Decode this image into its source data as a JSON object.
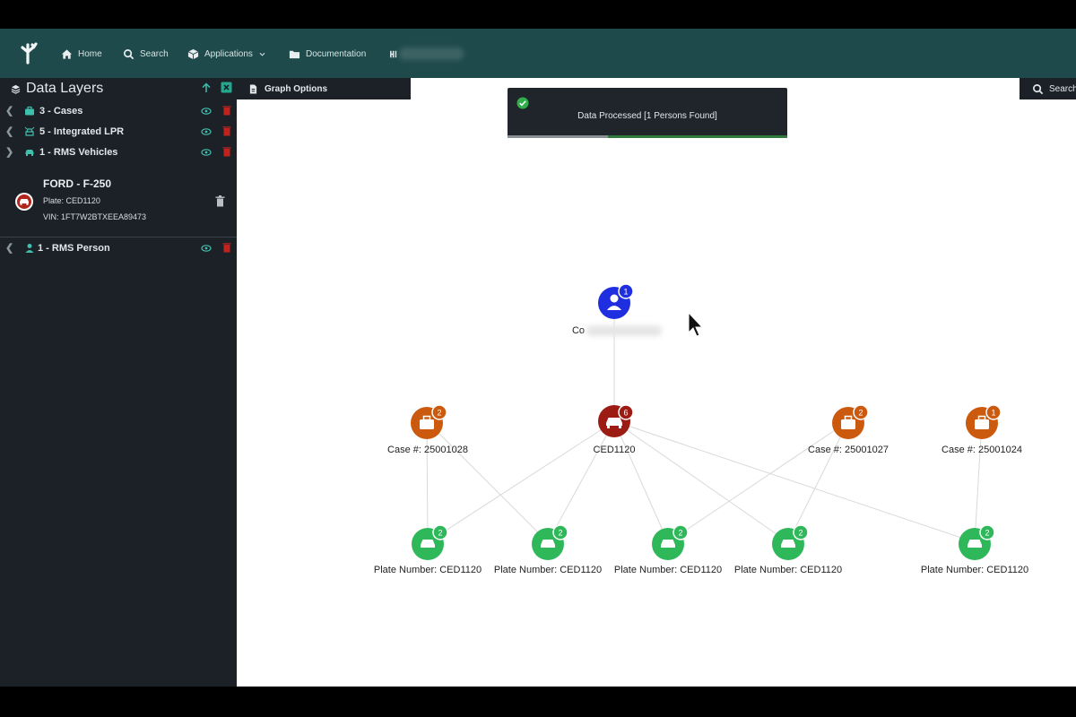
{
  "nav": {
    "items": [
      {
        "label": "Home",
        "icon": "home-icon"
      },
      {
        "label": "Search",
        "icon": "search-icon"
      },
      {
        "label": "Applications",
        "icon": "cube-icon"
      },
      {
        "label": "Documentation",
        "icon": "folder-icon"
      }
    ]
  },
  "sidebar": {
    "title": "Data Layers",
    "layers": [
      {
        "label": "3 - Cases",
        "icon": "briefcase-icon",
        "expanded": false
      },
      {
        "label": "5 - Integrated LPR",
        "icon": "lpr-camera-icon",
        "expanded": false
      },
      {
        "label": "1 - RMS Vehicles",
        "icon": "car-icon",
        "expanded": true
      }
    ],
    "vehicle": {
      "title": "FORD - F-250",
      "plate": "Plate: CED1120",
      "vin": "VIN: 1FT7W2BTXEEA89473"
    },
    "person_layer": {
      "label": "1 - RMS Person",
      "icon": "person-icon"
    }
  },
  "graph_options": {
    "label": "Graph Options"
  },
  "search_tab": {
    "label": "Search"
  },
  "toast": {
    "message": "Data Processed [1 Persons Found]",
    "progress": 0.36
  },
  "graph": {
    "person": {
      "label": "Co",
      "badge": "1"
    },
    "vehicle": {
      "label": "CED1120",
      "badge": "6"
    },
    "cases": [
      {
        "label": "Case #: 25001028",
        "badge": "2"
      },
      {
        "label": "Case #: 25001027",
        "badge": "2"
      },
      {
        "label": "Case #: 25001024",
        "badge": "1"
      }
    ],
    "plates": [
      {
        "label": "Plate Number: CED1120",
        "badge": "2"
      },
      {
        "label": "Plate Number: CED1120",
        "badge": "2"
      },
      {
        "label": "Plate Number: CED1120",
        "badge": "2"
      },
      {
        "label": "Plate Number: CED1120",
        "badge": "2"
      },
      {
        "label": "Plate Number: CED1120",
        "badge": "2"
      }
    ]
  },
  "colors": {
    "nav_bg": "#1f4a4b",
    "sidebar_bg": "#1c2127",
    "person_node": "#1f2fe0",
    "vehicle_node": "#9c1c14",
    "case_node": "#cc5a0e",
    "plate_node": "#2eb85a",
    "success": "#2fae4a"
  }
}
